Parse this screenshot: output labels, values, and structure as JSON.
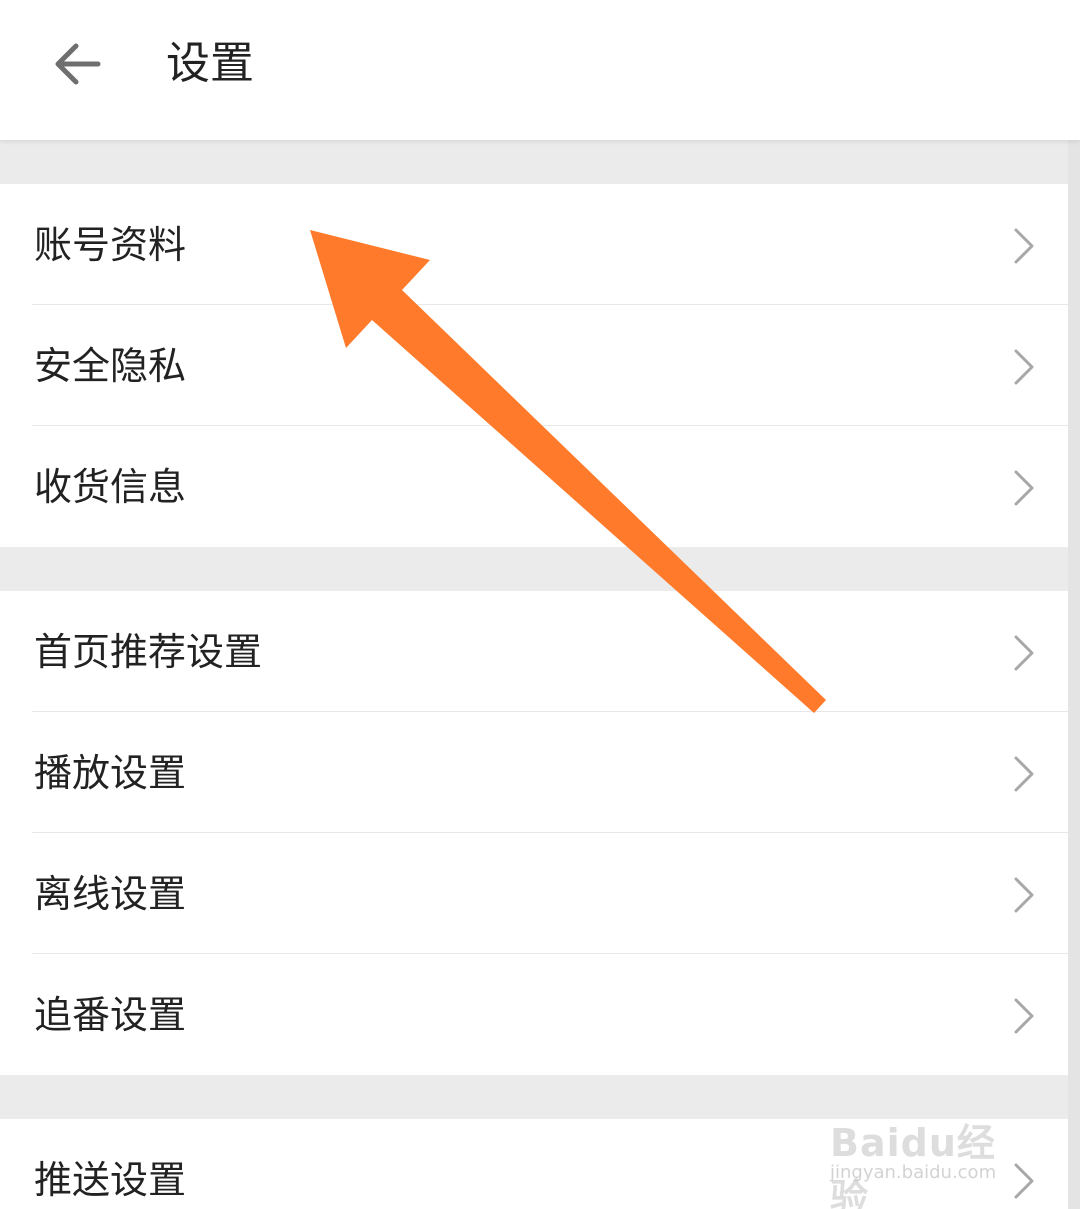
{
  "header": {
    "title": "设置",
    "back_icon": "arrow-left-icon"
  },
  "groups": [
    {
      "items": [
        {
          "label": "账号资料"
        },
        {
          "label": "安全隐私"
        },
        {
          "label": "收货信息"
        }
      ]
    },
    {
      "items": [
        {
          "label": "首页推荐设置"
        },
        {
          "label": "播放设置"
        },
        {
          "label": "离线设置"
        },
        {
          "label": "追番设置"
        }
      ]
    },
    {
      "items": [
        {
          "label": "推送设置"
        }
      ]
    }
  ],
  "annotation": {
    "color": "#ff7a2a",
    "points_to": "账号资料"
  },
  "watermark": {
    "logo": "Baidu经验",
    "url": "jingyan.baidu.com"
  },
  "colors": {
    "background": "#ebebeb",
    "surface": "#ffffff",
    "text": "#222222",
    "chevron": "#a8a8a8"
  }
}
